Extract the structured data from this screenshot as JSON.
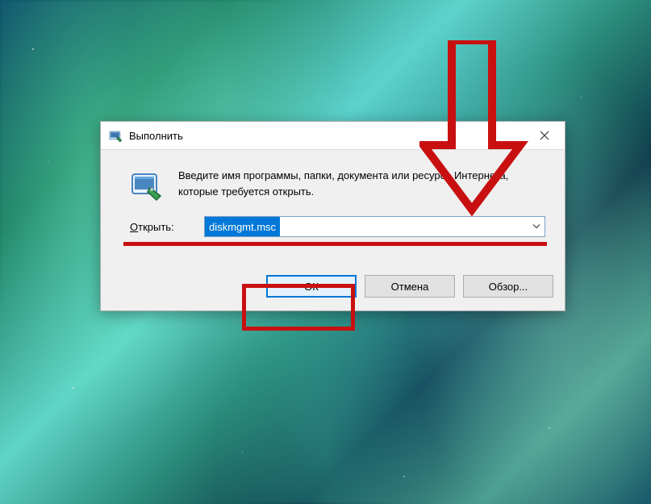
{
  "dialog": {
    "title": "Выполнить",
    "prompt": "Введите имя программы, папки, документа или ресурса Интернета, которые требуется открыть.",
    "open_label": "Открыть:",
    "input_value": "diskmgmt.msc",
    "buttons": {
      "ok": "ОК",
      "cancel": "Отмена",
      "browse": "Обзор..."
    }
  },
  "colors": {
    "annotation": "#c91010",
    "accent": "#0078d7"
  }
}
